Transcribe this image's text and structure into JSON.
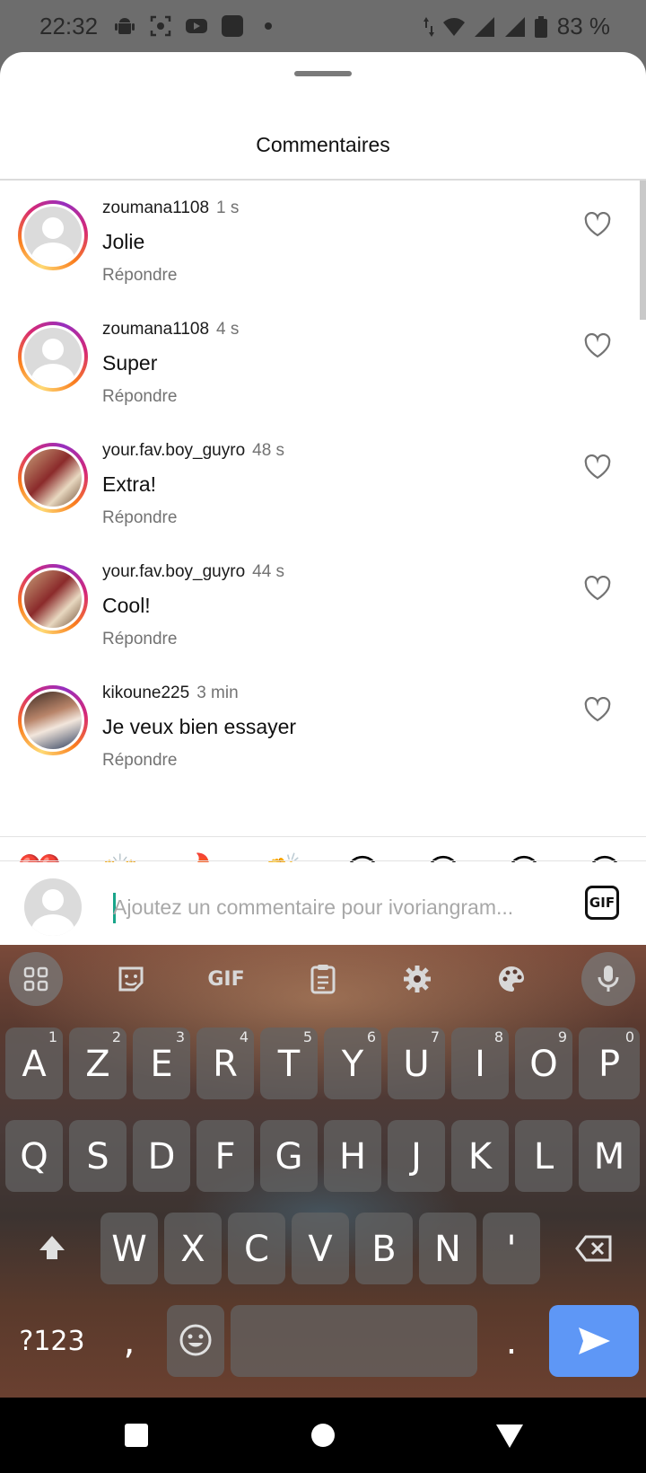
{
  "status_bar": {
    "time": "22:32",
    "battery": "83 %",
    "icons_left": [
      "android-icon",
      "screenshot-icon",
      "youtube-icon",
      "app-icon",
      "dot-icon"
    ],
    "icons_right": [
      "data-arrows-icon",
      "wifi-icon",
      "signal-icon",
      "signal-icon",
      "battery-icon"
    ]
  },
  "sheet": {
    "title": "Commentaires"
  },
  "comments": [
    {
      "username": "zoumana1108",
      "time": "1 s",
      "text": "Jolie",
      "reply_label": "Répondre",
      "avatar": "default"
    },
    {
      "username": "zoumana1108",
      "time": "4 s",
      "text": "Super",
      "reply_label": "Répondre",
      "avatar": "default"
    },
    {
      "username": "your.fav.boy_guyro",
      "time": "48 s",
      "text": "Extra!",
      "reply_label": "Répondre",
      "avatar": "photo"
    },
    {
      "username": "your.fav.boy_guyro",
      "time": "44 s",
      "text": "Cool!",
      "reply_label": "Répondre",
      "avatar": "photo"
    },
    {
      "username": "kikoune225",
      "time": "3 min",
      "text": "Je veux bien essayer",
      "reply_label": "Répondre",
      "avatar": "photo"
    }
  ],
  "emoji_bar": [
    "❤️",
    "🙌",
    "🔥",
    "👏",
    "😢",
    "😍",
    "😮",
    "😂"
  ],
  "composer": {
    "placeholder": "Ajoutez un commentaire pour ivoriangram...",
    "gif_label": "GIF"
  },
  "keyboard": {
    "toolbar": [
      "apps-grid-icon",
      "sticker-icon",
      "GIF",
      "clipboard-icon",
      "gear-icon",
      "palette-icon",
      "mic-icon"
    ],
    "row1": [
      {
        "key": "A",
        "hint": "1"
      },
      {
        "key": "Z",
        "hint": "2"
      },
      {
        "key": "E",
        "hint": "3"
      },
      {
        "key": "R",
        "hint": "4"
      },
      {
        "key": "T",
        "hint": "5"
      },
      {
        "key": "Y",
        "hint": "6"
      },
      {
        "key": "U",
        "hint": "7"
      },
      {
        "key": "I",
        "hint": "8"
      },
      {
        "key": "O",
        "hint": "9"
      },
      {
        "key": "P",
        "hint": "0"
      }
    ],
    "row2": [
      "Q",
      "S",
      "D",
      "F",
      "G",
      "H",
      "J",
      "K",
      "L",
      "M"
    ],
    "row3": [
      "W",
      "X",
      "C",
      "V",
      "B",
      "N",
      "'"
    ],
    "symbols_label": "?123",
    "comma": ",",
    "period": "."
  }
}
